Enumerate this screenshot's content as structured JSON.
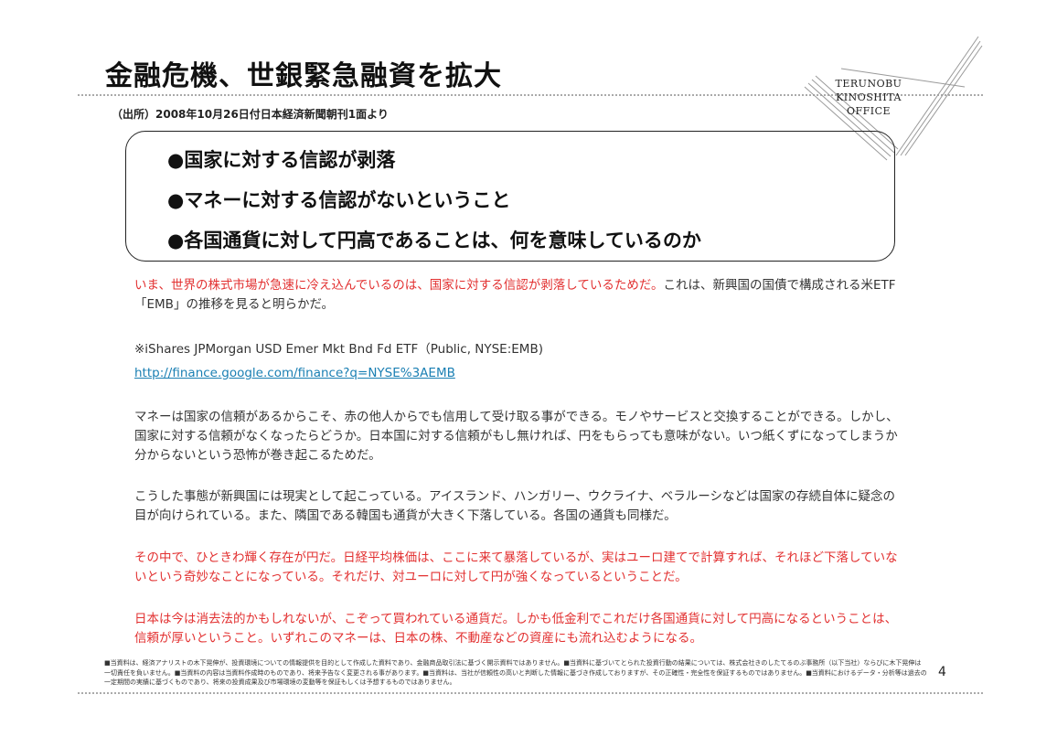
{
  "header": {
    "title": "金融危機、世銀緊急融資を拡大",
    "source": "（出所）2008年10月26日付日本経済新聞朝刊1面より",
    "logo": [
      "TERUNOBU",
      "KINOSHITA",
      "OFFICE"
    ]
  },
  "box": {
    "bullets": [
      "●国家に対する信認が剥落",
      "●マネーに対する信認がないということ",
      "●各国通貨に対して円高であることは、何を意味しているのか"
    ]
  },
  "body": {
    "p1_red": "いま、世界の株式市場が急速に冷え込んでいるのは、国家に対する信認が剥落しているためだ。",
    "p1_rest": "これは、新興国の国債で構成される米ETF「EMB」の推移を見ると明らかだ。",
    "p2": "※iShares JPMorgan USD Emer Mkt Bnd Fd ETF（Public, NYSE:EMB)",
    "link": "http://finance.google.com/finance?q=NYSE%3AEMB",
    "p3": "マネーは国家の信頼があるからこそ、赤の他人からでも信用して受け取る事ができる。モノやサービスと交換することができる。しかし、国家に対する信頼がなくなったらどうか。日本国に対する信頼がもし無ければ、円をもらっても意味がない。いつ紙くずになってしまうか分からないという恐怖が巻き起こるためだ。",
    "p4": "こうした事態が新興国には現実として起こっている。アイスランド、ハンガリー、ウクライナ、ベラルーシなどは国家の存続自体に疑念の目が向けられている。また、隣国である韓国も通貨が大きく下落している。各国の通貨も同様だ。",
    "p5": "その中で、ひときわ輝く存在が円だ。日経平均株価は、ここに来て暴落しているが、実はユーロ建てで計算すれば、それほど下落していないという奇妙なことになっている。それだけ、対ユーロに対して円が強くなっているということだ。",
    "p6": "日本は今は消去法的かもしれないが、こぞって買われている通貨だ。しかも低金利でこれだけ各国通貨に対して円高になるということは、信頼が厚いということ。いずれこのマネーは、日本の株、不動産などの資産にも流れ込むようになる。"
  },
  "footer": {
    "disclaimer": "■当資料は、経済アナリストの木下晃伸が、投資環境についての情報提供を目的として作成した資料であり、金融商品取引法に基づく開示資料ではありません。■当資料に基づいてとられた投資行動の結果については、株式会社きのしたてるのぶ事務所（以下当社）ならびに木下晃伸は一切責任を負いません。■当資料の内容は当資料作成時のものであり、将来予告なく変更される事があります。■当資料は、当社が信頼性の高いと判断した情報に基づき作成しておりますが、その正確性・完全性を保証するものではありません。■当資料におけるデータ・分析等は過去の一定期間の実績に基づくものであり、将来の投資成果及び市場環境の変動等を保証もしくは予想するものではありません。",
    "page": "4"
  }
}
